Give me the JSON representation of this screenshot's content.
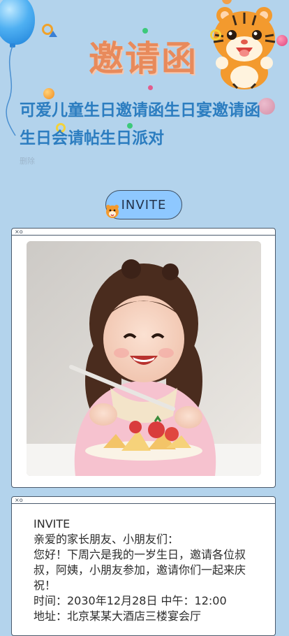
{
  "header": {
    "title": "邀请函",
    "headline": "可爱儿童生日邀请函生日宴邀请函生日会请帖生日派对",
    "small_text": "删除"
  },
  "invite_button": {
    "label": "INVITE"
  },
  "photo_card": {
    "controls": "×o"
  },
  "text_card": {
    "controls": "×o",
    "heading": "INVITE",
    "greeting": "亲爱的家长朋友、小朋友们：",
    "message": "您好！下周六是我的一岁生日，邀请各位叔叔，阿姨，小朋友参加，邀请你们一起来庆祝！",
    "time": "时间：2030年12月28日  中午：12:00",
    "address": "地址：北京某某大酒店三楼宴会厅"
  },
  "colors": {
    "background": "#b3d3ec",
    "title": "#e88a5b",
    "headline": "#2c7dc0",
    "pill": "#8ec8ff"
  }
}
